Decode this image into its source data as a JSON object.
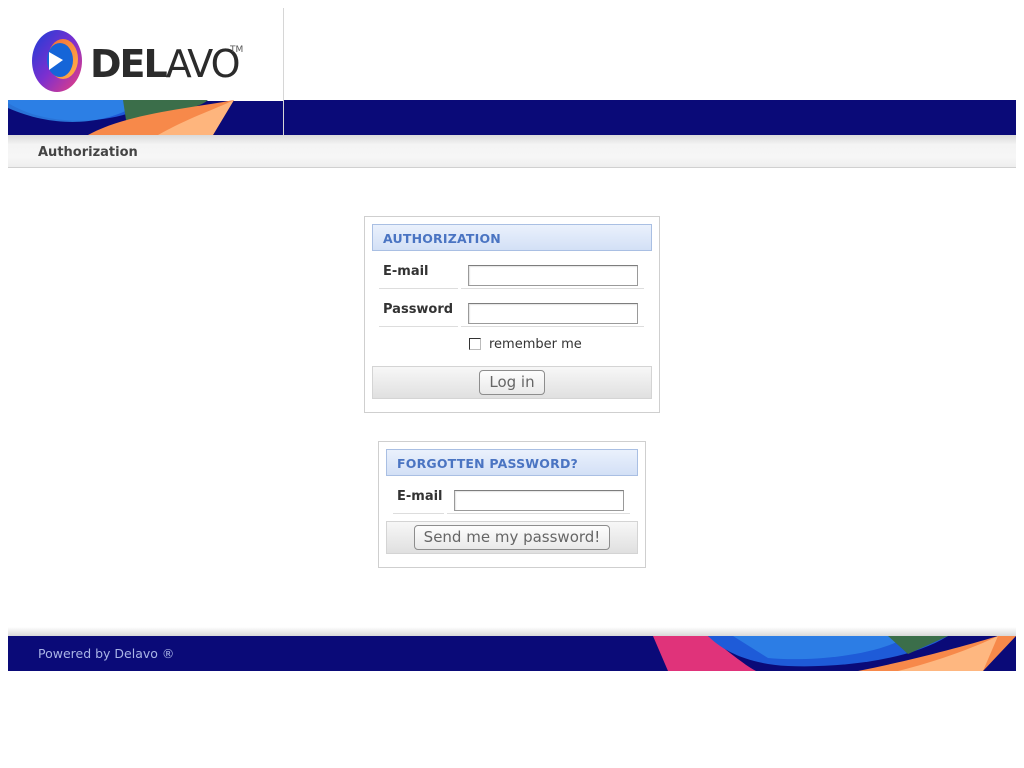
{
  "brand": {
    "word_bold": "DEL",
    "word_light": "AVO",
    "trademark": "TM"
  },
  "breadcrumb": {
    "label": "Authorization"
  },
  "login": {
    "title": "AUTHORIZATION",
    "email_label": "E-mail",
    "email_value": "",
    "password_label": "Password",
    "password_value": "",
    "remember_label": "remember me",
    "remember_checked": false,
    "submit_label": "Log in"
  },
  "forgot": {
    "title": "FORGOTTEN PASSWORD?",
    "email_label": "E-mail",
    "email_value": "",
    "submit_label": "Send me my password!"
  },
  "footer": {
    "powered_text": "Powered by Delavo ®"
  },
  "colors": {
    "navy_band": "#0a0a78",
    "panel_title_text": "#4a74c2",
    "panel_title_border": "#a9bfe3"
  }
}
